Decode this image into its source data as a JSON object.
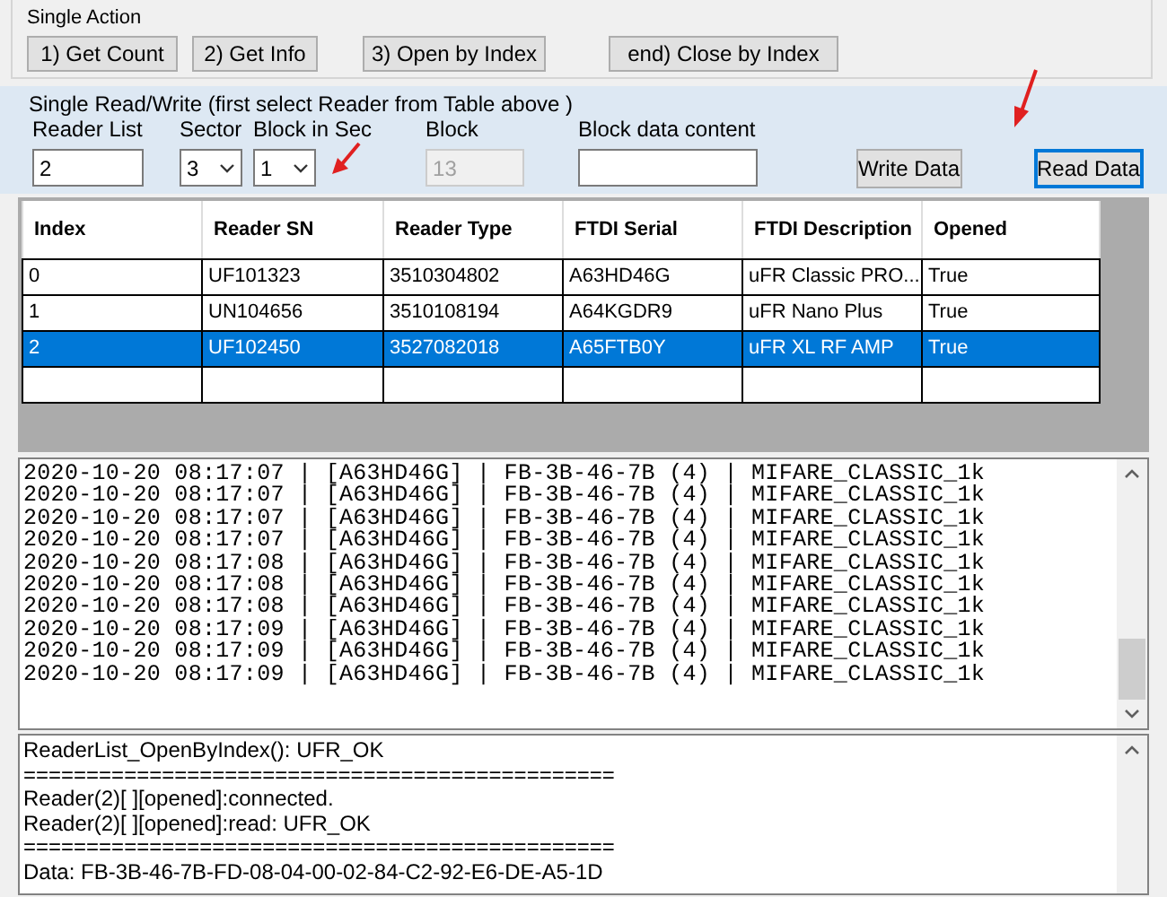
{
  "single_action": {
    "title": "Single Action",
    "buttons": [
      "1) Get Count",
      "2) Get Info",
      "3) Open by Index",
      "end) Close by Index"
    ]
  },
  "single_read_write": {
    "title": "Single Read/Write  (first select Reader from Table above )",
    "reader_list": {
      "label": "Reader List",
      "value": "2"
    },
    "sector": {
      "label": "Sector",
      "value": "3"
    },
    "block_in_sec": {
      "label": "Block in Sec",
      "value": "1"
    },
    "block": {
      "label": "Block",
      "value": "13",
      "disabled": true
    },
    "block_data_content": {
      "label": "Block data content"
    },
    "buttons": [
      {
        "label": "Write Data",
        "focused": false
      },
      {
        "label": "Read Data",
        "focused": true
      }
    ]
  },
  "table": {
    "columns": [
      "Index",
      "Reader SN",
      "Reader Type",
      "FTDI Serial",
      "FTDI Description",
      "Opened"
    ],
    "rows": [
      {
        "cells": [
          "0",
          "UF101323",
          "3510304802",
          "A63HD46G",
          "uFR Classic PRO...",
          "True"
        ],
        "selected": false
      },
      {
        "cells": [
          "1",
          "UN104656",
          "3510108194",
          "A64KGDR9",
          "uFR Nano Plus",
          "True"
        ],
        "selected": false
      },
      {
        "cells": [
          "2",
          "UF102450",
          "3527082018",
          "A65FTB0Y",
          "uFR XL RF AMP",
          "True"
        ],
        "selected": true
      }
    ]
  },
  "log": {
    "lines": [
      "2020-10-20 08:17:07 | [A63HD46G] | FB-3B-46-7B (4) | MIFARE_CLASSIC_1k",
      "2020-10-20 08:17:07 | [A63HD46G] | FB-3B-46-7B (4) | MIFARE_CLASSIC_1k",
      "2020-10-20 08:17:07 | [A63HD46G] | FB-3B-46-7B (4) | MIFARE_CLASSIC_1k",
      "2020-10-20 08:17:07 | [A63HD46G] | FB-3B-46-7B (4) | MIFARE_CLASSIC_1k",
      "2020-10-20 08:17:08 | [A63HD46G] | FB-3B-46-7B (4) | MIFARE_CLASSIC_1k",
      "2020-10-20 08:17:08 | [A63HD46G] | FB-3B-46-7B (4) | MIFARE_CLASSIC_1k",
      "2020-10-20 08:17:08 | [A63HD46G] | FB-3B-46-7B (4) | MIFARE_CLASSIC_1k",
      "2020-10-20 08:17:09 | [A63HD46G] | FB-3B-46-7B (4) | MIFARE_CLASSIC_1k",
      "2020-10-20 08:17:09 | [A63HD46G] | FB-3B-46-7B (4) | MIFARE_CLASSIC_1k",
      "2020-10-20 08:17:09 | [A63HD46G] | FB-3B-46-7B (4) | MIFARE_CLASSIC_1k"
    ]
  },
  "output": {
    "lines": [
      "ReaderList_OpenByIndex(): UFR_OK",
      "===============================================",
      "Reader(2)[ ][opened]:connected.",
      "Reader(2)[ ][opened]:read: UFR_OK",
      "===============================================",
      "Data: FB-3B-46-7B-FD-08-04-00-02-84-C2-92-E6-DE-A5-1D"
    ]
  }
}
